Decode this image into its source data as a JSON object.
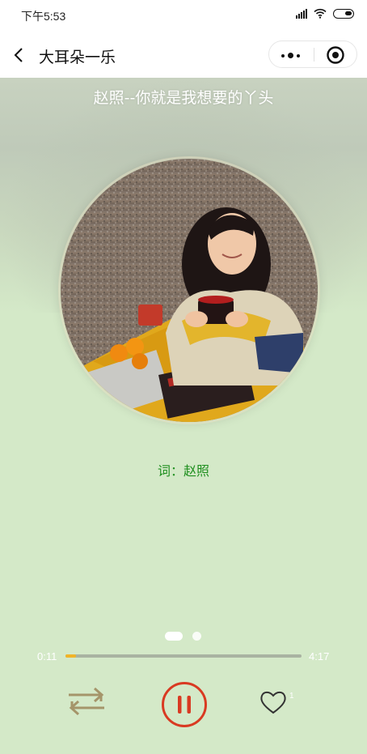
{
  "status_bar": {
    "time": "下午5:53"
  },
  "nav": {
    "back_icon": "chevron-left-icon",
    "title": "大耳朵一乐",
    "more_icon": "more-dots-icon",
    "close_icon": "target-circle-icon"
  },
  "player": {
    "song_title": "赵照--你就是我想要的丫头",
    "lyric_line": "词：赵照",
    "time_current": "0:11",
    "time_total": "4:17",
    "progress": 0.043,
    "like_count": "1",
    "repeat_icon": "repeat-icon",
    "pause_icon": "pause-icon",
    "like_icon": "heart-outline-icon",
    "page_count": 2,
    "page_active": 0
  },
  "colors": {
    "background": "#d4e9c8",
    "lyric": "#1f8f1f",
    "pause_ring": "#d93a22",
    "repeat": "#a5956a",
    "progress_fill": "#f0b428",
    "progress_track": "#a9b3a1"
  }
}
